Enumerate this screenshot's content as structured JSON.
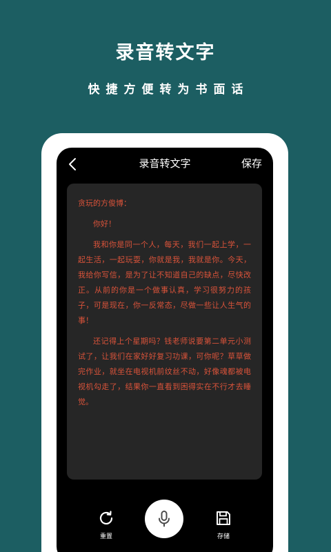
{
  "promo": {
    "title": "录音转文字",
    "subtitle": "快捷方便转为书面话"
  },
  "screen": {
    "title": "录音转文字",
    "save_label": "保存",
    "back_icon": "chevron-left-icon"
  },
  "transcript": {
    "greeting": "贪玩的方俊博：",
    "hello": "你好！",
    "paragraphs": [
      "我和你是同一个人，每天，我们一起上学，一起生活，一起玩耍，你就是我，我就是你。今天，我给你写信，是为了让不知道自己的缺点，尽快改正。从前的你是一个做事认真，学习很努力的孩子，可是现在，你一反常态，尽做一些让人生气的事！",
      "还记得上个星期吗？钱老师说要第二单元小测试了，让我们在家好好复习功课，可你呢？草草做完作业，就坐在电视机前纹丝不动，好像魂都被电视机勾走了，结果你一直看到困得实在不行才去睡觉。"
    ]
  },
  "toolbar": {
    "reset_label": "重置",
    "store_label": "存储",
    "reset_icon": "refresh-icon",
    "mic_icon": "microphone-icon",
    "store_icon": "save-disk-icon"
  },
  "colors": {
    "background": "#1c5e62",
    "text_accent": "#d9533a",
    "card": "#262626"
  }
}
